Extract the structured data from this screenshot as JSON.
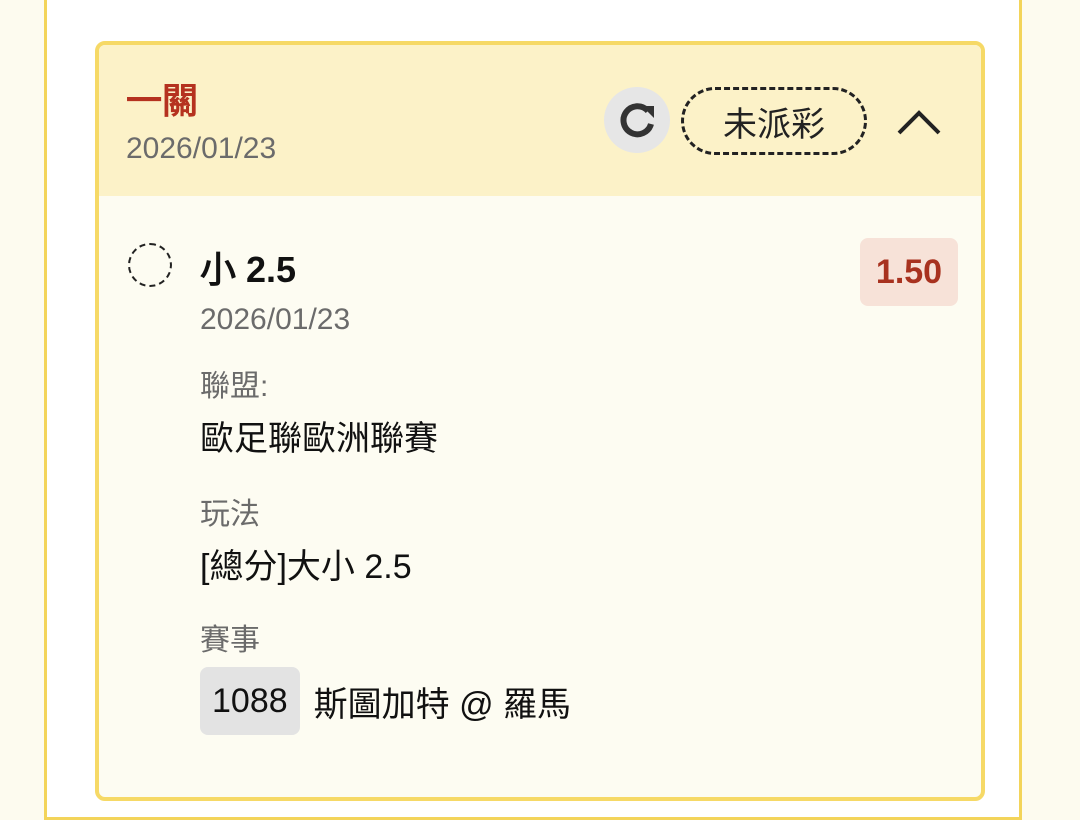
{
  "header": {
    "bet_type": "一關",
    "date": "2026/01/23",
    "status": "未派彩"
  },
  "selection": {
    "name": "小 2.5",
    "date": "2026/01/23",
    "odds": "1.50",
    "league_label": "聯盟:",
    "league_value": "歐足聯歐洲聯賽",
    "play_label": "玩法",
    "play_value": "[總分]大小 2.5",
    "match_label": "賽事",
    "match_id": "1088",
    "match_name": "斯圖加特 @ 羅馬"
  },
  "icons": {
    "refresh": "refresh-icon",
    "collapse": "chevron-up-icon",
    "selection": "dashed-circle-icon"
  },
  "colors": {
    "accent_red": "#b5321f",
    "header_bg": "#fcf2c8",
    "border_yellow": "#f6d966",
    "odds_bg": "#f7e2d8"
  }
}
